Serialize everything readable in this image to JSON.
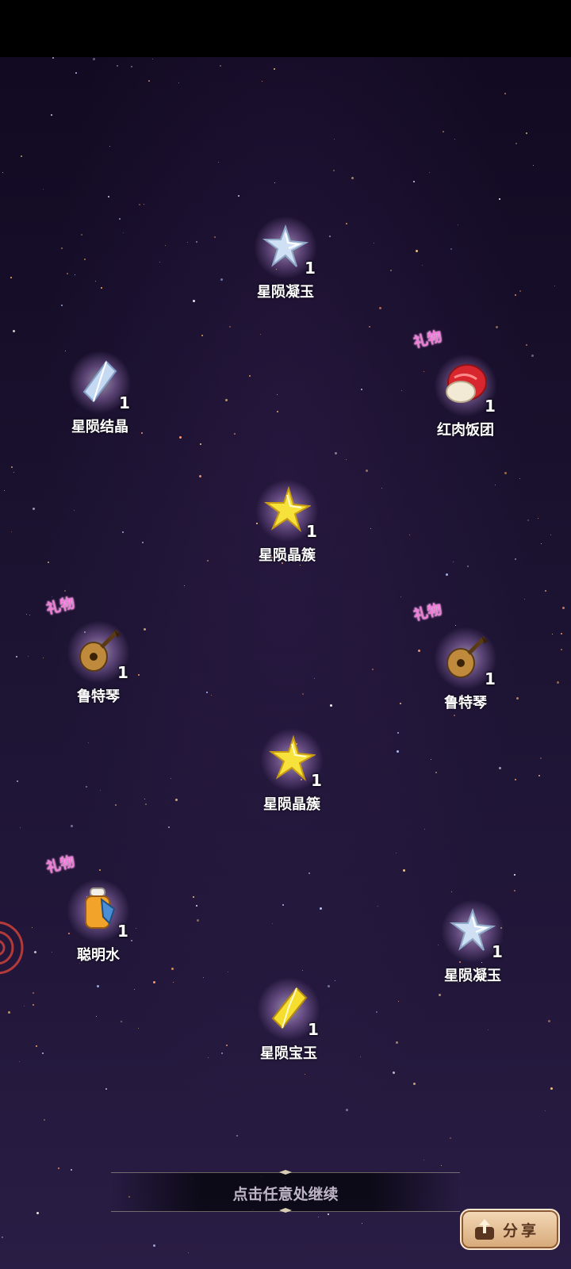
{
  "rewards": [
    {
      "name": "星陨凝玉",
      "count": "1",
      "gift": false,
      "icon": "pale-blue-star-crystal-icon"
    },
    {
      "name": "星陨结晶",
      "count": "1",
      "gift": false,
      "icon": "pale-blue-shard-icon"
    },
    {
      "name": "红肉饭团",
      "count": "1",
      "gift": true,
      "icon": "red-meat-rice-ball-icon"
    },
    {
      "name": "星陨晶簇",
      "count": "1",
      "gift": false,
      "icon": "gold-star-crystal-icon"
    },
    {
      "name": "鲁特琴",
      "count": "1",
      "gift": true,
      "icon": "lute-icon"
    },
    {
      "name": "鲁特琴",
      "count": "1",
      "gift": true,
      "icon": "lute-icon"
    },
    {
      "name": "星陨晶簇",
      "count": "1",
      "gift": false,
      "icon": "gold-star-crystal-icon"
    },
    {
      "name": "聪明水",
      "count": "1",
      "gift": true,
      "icon": "potion-bottle-icon"
    },
    {
      "name": "星陨凝玉",
      "count": "1",
      "gift": false,
      "icon": "pale-blue-star-crystal-icon"
    },
    {
      "name": "星陨宝玉",
      "count": "1",
      "gift": false,
      "icon": "gold-shard-icon"
    }
  ],
  "gift_badge": "礼物",
  "continue_hint": "点击任意处继续",
  "share_button": "分享",
  "colors": {
    "gift": "#f07ad8",
    "background": "#1b1230",
    "share_bg": "#e6c19a"
  }
}
